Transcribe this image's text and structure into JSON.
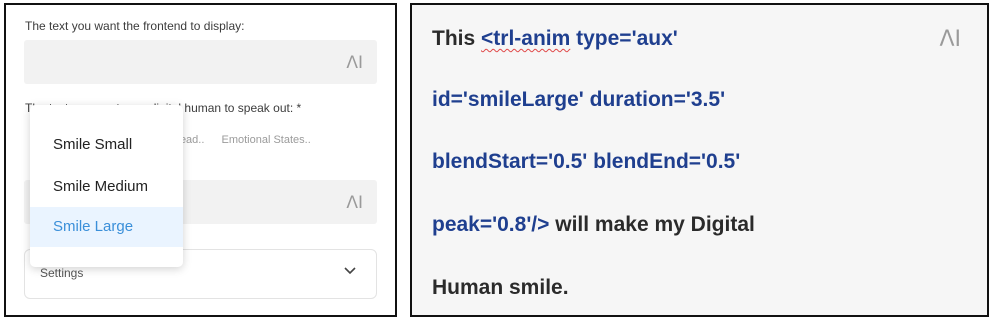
{
  "left_panel": {
    "frontend_label": "The text you want the frontend to display:",
    "speak_label": "The text you want your digital human to speak out: *",
    "tabs": [
      "Head..",
      "Emotional States.."
    ],
    "ai_icon": "ΛI",
    "dropdown": {
      "items": [
        "Smile Small",
        "Smile Medium",
        "Smile Large"
      ],
      "selected": "Smile Large"
    },
    "settings_label": "Settings"
  },
  "right_panel": {
    "ai_icon": "ΛI",
    "lines": [
      {
        "plain_before": "This ",
        "code_squiggle": "<trl-anim",
        "code": " type='aux'"
      },
      {
        "code": "id='smileLarge' duration='3.5'"
      },
      {
        "code": "blendStart='0.5' blendEnd='0.5'"
      },
      {
        "code": "peak='0.8'/>",
        "plain_after": " will make my Digital"
      },
      {
        "plain_before": "Human smile."
      }
    ]
  },
  "colors": {
    "accent": "#3a8fd9",
    "code_text": "#1f3f8f",
    "selected_bg": "#eaf4ff"
  }
}
